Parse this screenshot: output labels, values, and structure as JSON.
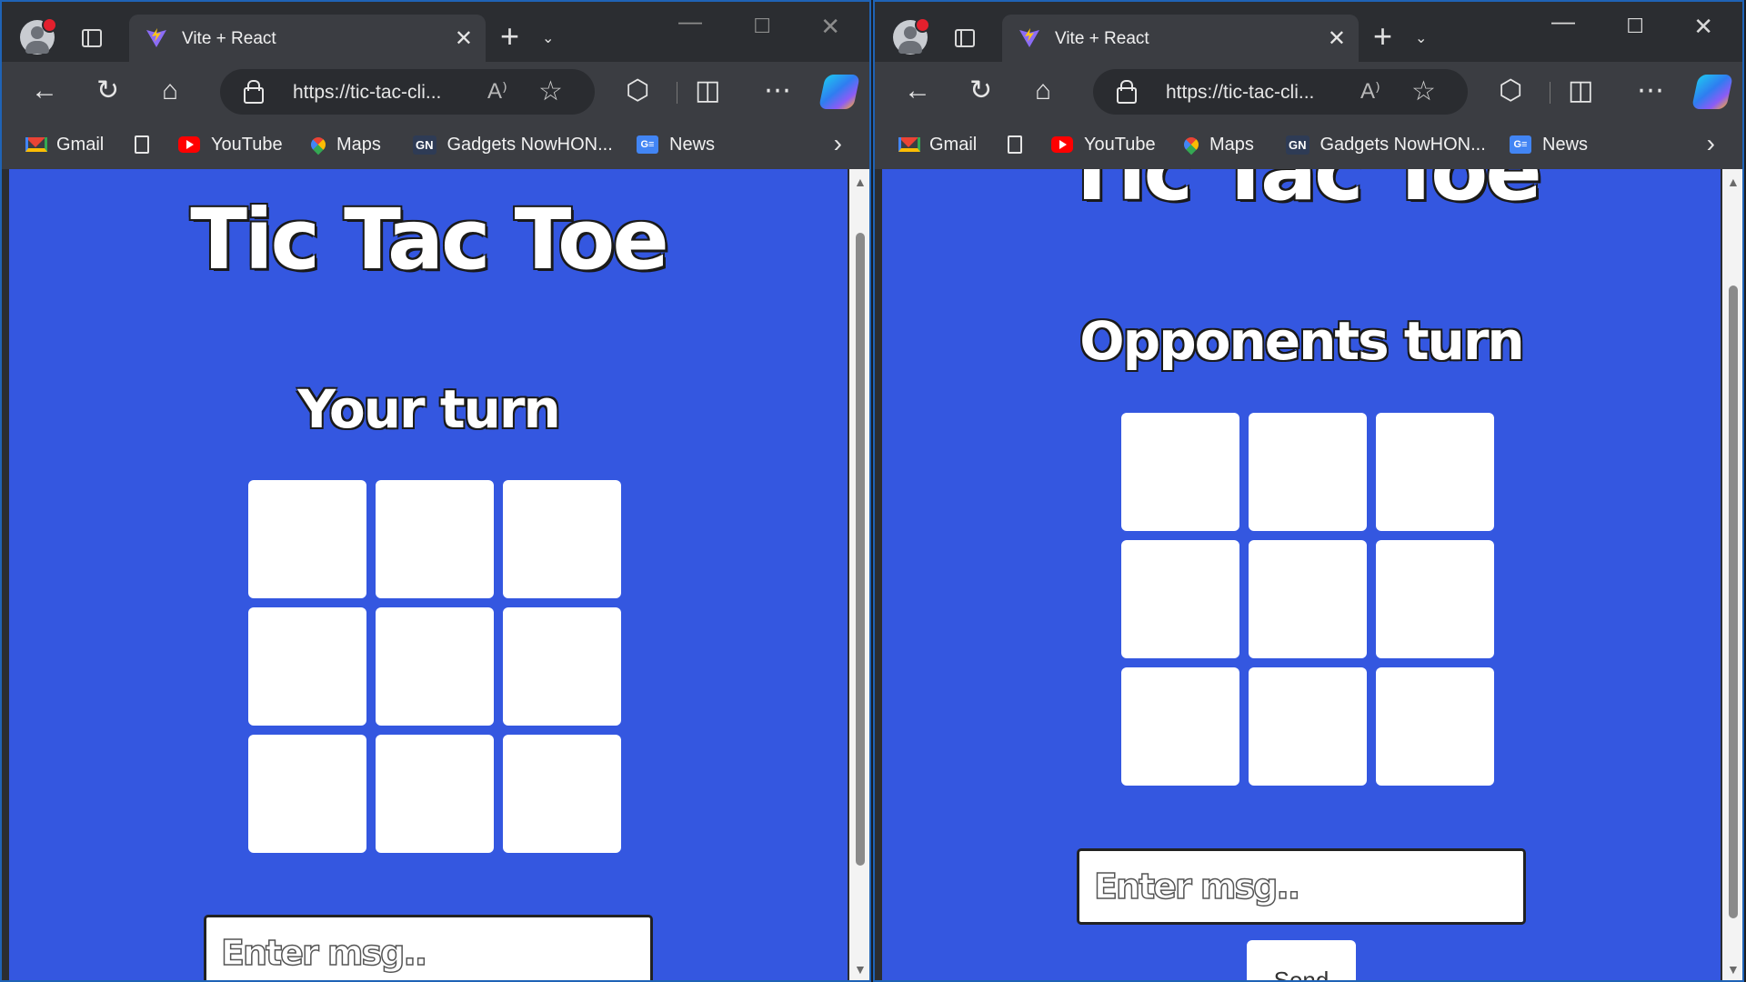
{
  "browser": {
    "tab_title": "Vite + React",
    "tab_close": "✕",
    "new_tab": "+",
    "tab_list": "⌄",
    "url": "https://tic-tac-cli...",
    "read_aloud": "A⁾",
    "window_controls": {
      "minimize": "—",
      "maximize": "☐",
      "close": "✕"
    },
    "favorites": [
      "Gmail",
      "YouTube",
      "Maps",
      "Gadgets NowHON...",
      "News"
    ],
    "favorites_icons": {
      "gadgets": "GN",
      "news": "G≡"
    }
  },
  "left_window": {
    "title": "Tic Tac Toe",
    "turn": "Your turn",
    "board": [
      "",
      "",
      "",
      "",
      "",
      "",
      "",
      "",
      ""
    ],
    "message_placeholder": "Enter msg.."
  },
  "right_window": {
    "title": "Tic Tac Toe",
    "turn": "Opponents turn",
    "board": [
      "",
      "",
      "",
      "",
      "",
      "",
      "",
      "",
      ""
    ],
    "message_placeholder": "Enter msg..",
    "send_label": "Send"
  },
  "colors": {
    "page_background": "#3457e0",
    "cell": "#ffffff",
    "browser_chrome": "#3b3d42"
  }
}
